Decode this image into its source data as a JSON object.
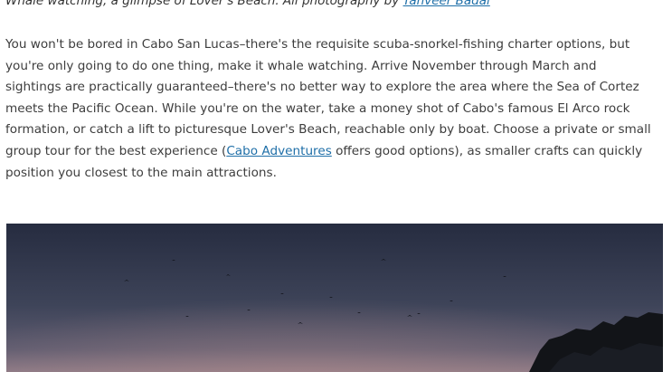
{
  "caption": {
    "text": "Whale watching, a glimpse of Lover's Beach. All photography by ",
    "credit_link": "Tanveer Badal"
  },
  "body": {
    "line1": "You won't be bored in Cabo San Lucas–there's the requisite scuba-snorkel-fishing charter options, but",
    "line2": "you're only going to do one thing, make it whale watching. Arrive November through March and",
    "line3": "sightings are practically guaranteed–there's no better way to explore the area where the Sea of Cortez",
    "line4": "meets the Pacific Ocean. While you're on the water, take a money shot of Cabo's famous El Arco rock",
    "line5": "formation, or catch a lift to picturesque Lover's Beach, reachable only by boat. Choose a private or small",
    "line6_before": "group tour for the best experience (",
    "line6_link": "Cabo Adventures",
    "line6_after": " offers good options), as smaller crafts can quickly",
    "line7": "position you closest to the main attractions."
  },
  "photo": {
    "subject": "dusk sky with flying birds and dark rock silhouette",
    "colors": {
      "sky_top": "#2a3044",
      "sky_mid": "#4a4f66",
      "sky_low": "#8a7a8a",
      "rock": "#121418"
    }
  }
}
